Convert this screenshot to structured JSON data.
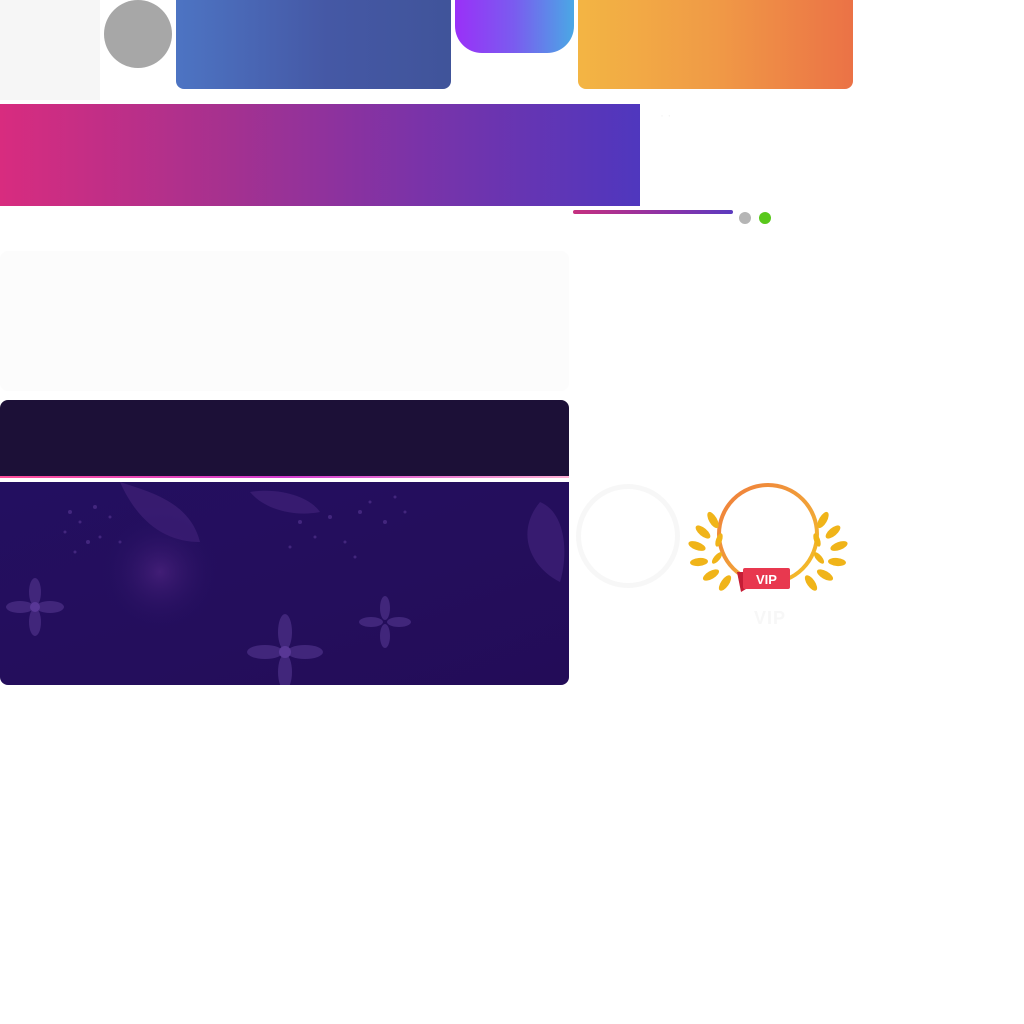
{
  "banner": {
    "side_text": "· ·"
  },
  "carousel": {
    "caption": ""
  },
  "vip": {
    "badge_text": "VIP",
    "label": "VIP"
  },
  "colors": {
    "blue_banner": "#4558a5",
    "orange_banner": "#f09a46",
    "promo_start": "#d82c7f",
    "promo_end": "#4f37be",
    "active_dot": "#59c81c",
    "inactive_dot": "#b5b5b5",
    "dark_header": "#1c1037",
    "purple_panel": "#230f60",
    "vip_gold": "#f0b419",
    "vip_red": "#e8384f"
  }
}
